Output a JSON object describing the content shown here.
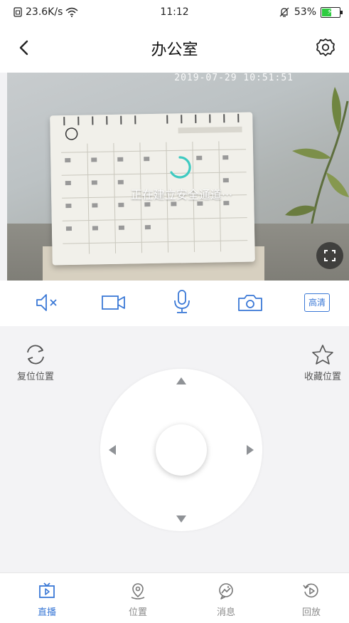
{
  "status_bar": {
    "speed": "23.6K/s",
    "time": "11:12",
    "battery": "53%",
    "battery_level": 0.53,
    "battery_color": "#2ecc40"
  },
  "header": {
    "title": "办公室",
    "back_icon": "chevron-left-icon",
    "settings_icon": "gear-icon"
  },
  "video": {
    "timestamp": "2019-07-29 10:51:51",
    "loading_text": "正在建立安全通道···",
    "spinner_color": "#3ecac1",
    "fullscreen_icon": "fullscreen-icon"
  },
  "controls": {
    "mute_icon": "speaker-mute-icon",
    "record_icon": "video-record-icon",
    "mic_icon": "microphone-icon",
    "snapshot_icon": "camera-icon",
    "quality_label": "高清",
    "accent": "#3a78d6"
  },
  "ptz": {
    "reset_label": "复位位置",
    "favorite_label": "收藏位置"
  },
  "nav": {
    "items": [
      {
        "label": "直播",
        "icon": "live-tv-icon",
        "active": true
      },
      {
        "label": "位置",
        "icon": "location-pin-icon",
        "active": false
      },
      {
        "label": "消息",
        "icon": "message-icon",
        "active": false
      },
      {
        "label": "回放",
        "icon": "playback-icon",
        "active": false
      }
    ]
  }
}
